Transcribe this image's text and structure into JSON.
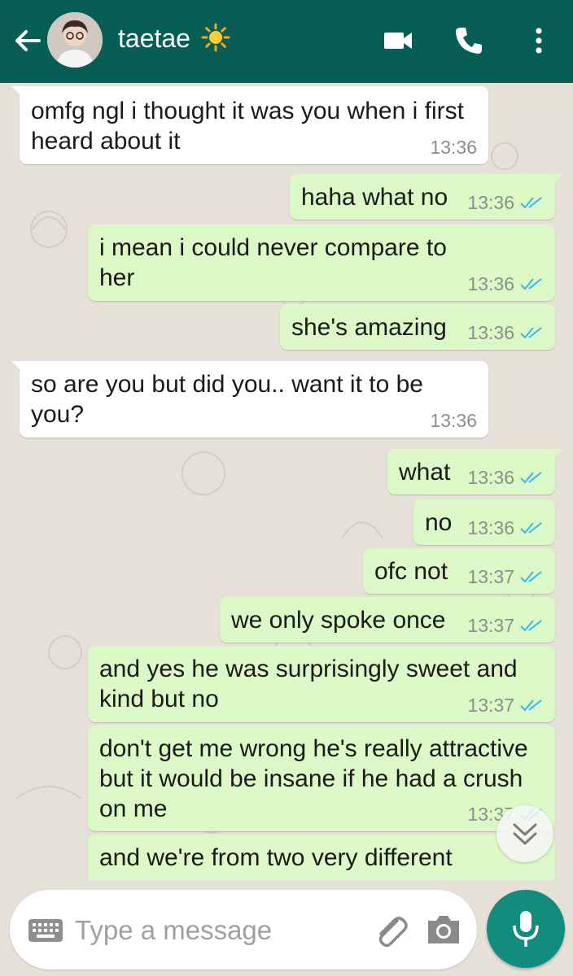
{
  "header": {
    "contact_name": "taetae",
    "status_emoji_icon": "sun-icon",
    "back_icon": "arrow-left-icon",
    "video_icon": "video-camera-icon",
    "call_icon": "phone-icon",
    "menu_icon": "more-vertical-icon",
    "bar_color": "#075e54"
  },
  "messages": [
    {
      "direction": "in",
      "text": "omfg ngl i thought it was you when i first heard about it",
      "time": "13:36"
    },
    {
      "direction": "out",
      "text": "haha what no",
      "time": "13:36",
      "read": true
    },
    {
      "direction": "out",
      "text": "i mean i could never compare to her",
      "time": "13:36",
      "read": true
    },
    {
      "direction": "out",
      "text": "she's amazing",
      "time": "13:36",
      "read": true
    },
    {
      "direction": "in",
      "text": "so are you but did you.. want it to be you?",
      "time": "13:36"
    },
    {
      "direction": "out",
      "text": "what",
      "time": "13:36",
      "read": true
    },
    {
      "direction": "out",
      "text": "no",
      "time": "13:36",
      "read": true
    },
    {
      "direction": "out",
      "text": "ofc not",
      "time": "13:37",
      "read": true
    },
    {
      "direction": "out",
      "text": "we only spoke once",
      "time": "13:37",
      "read": true
    },
    {
      "direction": "out",
      "text": "and yes he was surprisingly sweet and kind but no",
      "time": "13:37",
      "read": true
    },
    {
      "direction": "out",
      "text": "don't get me wrong he's really attractive but it would be insane if he had a crush on me",
      "time": "13:37",
      "read": true
    },
    {
      "direction": "out",
      "text": "and we're from two very different",
      "time": "",
      "read": false
    }
  ],
  "composer": {
    "placeholder": "Type a message",
    "keyboard_icon": "keyboard-icon",
    "attach_icon": "paperclip-icon",
    "camera_icon": "camera-icon",
    "mic_icon": "microphone-icon",
    "scroll_icon": "double-chevron-down-icon",
    "send_color": "#128c7e"
  },
  "colors": {
    "incoming_bubble": "#ffffff",
    "outgoing_bubble": "#dcf8c6",
    "read_tick": "#34b7f1",
    "chat_background": "#e5e0d8"
  }
}
